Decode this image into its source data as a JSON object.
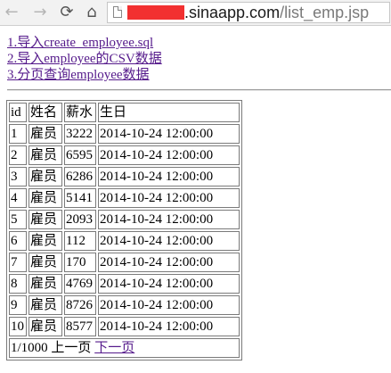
{
  "browser": {
    "back_icon": "←",
    "forward_icon": "→",
    "reload_icon": "⟳",
    "home_icon": "⌂",
    "url_host": ".sinaapp.com",
    "url_path": "/list_emp.jsp",
    "redaction_color": "#f23030"
  },
  "links": [
    "1.导入create_employee.sql",
    "2.导入employee的CSV数据",
    "3.分页查询employee数据"
  ],
  "table": {
    "headers": [
      "id",
      "姓名",
      "薪水",
      "生日"
    ],
    "rows": [
      [
        "1",
        "雇员",
        "3222",
        "2014-10-24 12:00:00"
      ],
      [
        "2",
        "雇员",
        "6595",
        "2014-10-24 12:00:00"
      ],
      [
        "3",
        "雇员",
        "6286",
        "2014-10-24 12:00:00"
      ],
      [
        "4",
        "雇员",
        "5141",
        "2014-10-24 12:00:00"
      ],
      [
        "5",
        "雇员",
        "2093",
        "2014-10-24 12:00:00"
      ],
      [
        "6",
        "雇员",
        "112",
        "2014-10-24 12:00:00"
      ],
      [
        "7",
        "雇员",
        "170",
        "2014-10-24 12:00:00"
      ],
      [
        "8",
        "雇员",
        "4769",
        "2014-10-24 12:00:00"
      ],
      [
        "9",
        "雇员",
        "8726",
        "2014-10-24 12:00:00"
      ],
      [
        "10",
        "雇员",
        "8577",
        "2014-10-24 12:00:00"
      ]
    ],
    "pager": {
      "position": "1/1000",
      "prev_label": "上一页",
      "next_label": "下一页"
    }
  }
}
